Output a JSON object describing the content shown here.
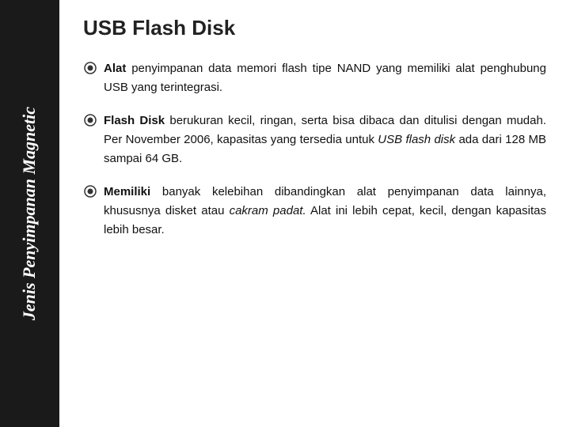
{
  "sidebar": {
    "text_line1": "Jenis",
    "text_line2": "Penyimpanan",
    "text_line3": "Magnetic",
    "full_text": "Jenis Penyimpanan Magnetic"
  },
  "header": {
    "title": "USB Flash Disk"
  },
  "bullets": [
    {
      "id": "bullet-1",
      "label": "Alat",
      "text": " penyimpanan data memori flash tipe NAND yang memiliki alat penghubung USB yang terintegrasi."
    },
    {
      "id": "bullet-2",
      "label": "Flash Disk",
      "text": " berukuran kecil, ringan, serta bisa dibaca dan ditulisi dengan mudah. Per November 2006, kapasitas yang tersedia untuk ",
      "italic_text": "USB flash disk",
      "text2": " ada dari 128 MB sampai 64 GB."
    },
    {
      "id": "bullet-3",
      "label": "Memiliki",
      "text": " banyak kelebihan dibandingkan alat penyimpanan data lainnya, khususnya disket atau ",
      "italic_text": "cakram padat.",
      "text2": " Alat ini lebih cepat, kecil, dengan kapasitas lebih besar."
    }
  ]
}
